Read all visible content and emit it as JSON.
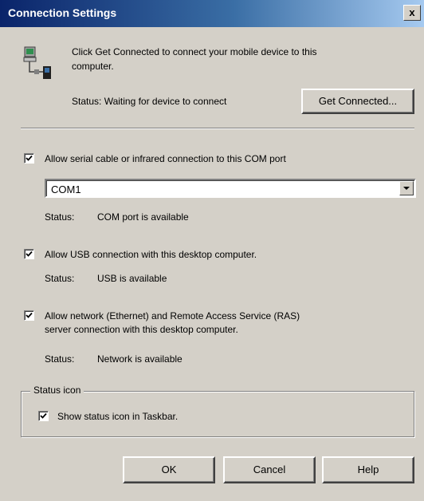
{
  "window": {
    "title": "Connection Settings",
    "close_label": "x"
  },
  "intro": {
    "line1": "Click Get Connected to connect your mobile device to this",
    "line2": "computer.",
    "status": "Status: Waiting for device to connect",
    "get_connected_label": "Get Connected..."
  },
  "serial": {
    "label": "Allow serial cable or infrared connection to this COM port",
    "checked": true,
    "port_value": "COM1",
    "status_label": "Status:",
    "status_value": "COM port is available"
  },
  "usb": {
    "label": "Allow USB connection with this desktop computer.",
    "checked": true,
    "status_label": "Status:",
    "status_value": "USB is available"
  },
  "network": {
    "label_line1": "Allow network (Ethernet) and Remote Access Service (RAS)",
    "label_line2": "server connection with this desktop computer.",
    "checked": true,
    "status_label": "Status:",
    "status_value": "Network is available"
  },
  "status_icon_group": {
    "legend": "Status icon",
    "show_label": "Show status icon in Taskbar.",
    "checked": true
  },
  "buttons": {
    "ok": "OK",
    "cancel": "Cancel",
    "help": "Help"
  },
  "colors": {
    "title_start": "#0a246a",
    "title_end": "#a6caf0",
    "face": "#d4d0c8"
  }
}
